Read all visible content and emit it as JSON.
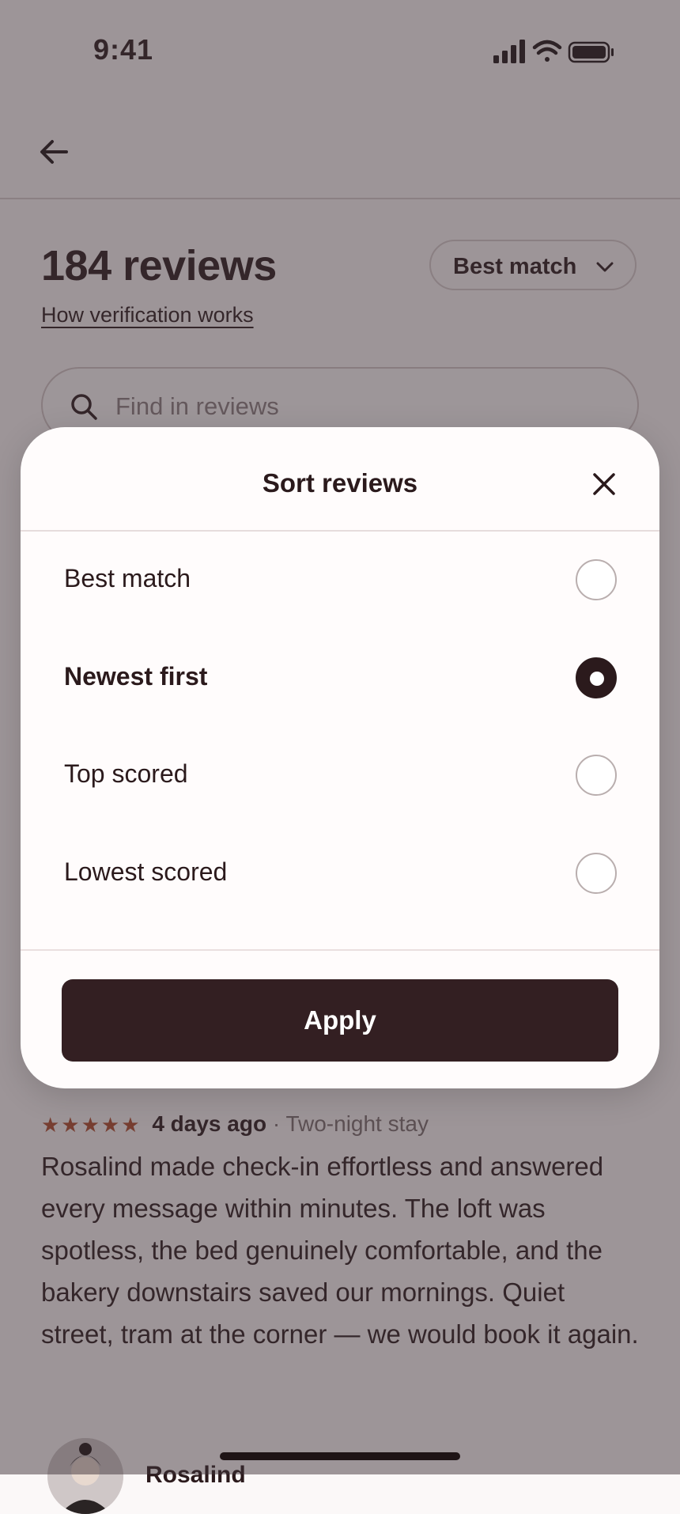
{
  "status_bar": {
    "time": "9:41"
  },
  "page": {
    "title": "184 reviews",
    "verification_link": "How verification works",
    "sort_pill_label": "Best match",
    "search_placeholder": "Find in reviews"
  },
  "review": {
    "stars": "★★★★★",
    "ago": "4 days ago",
    "stay": "· Two-night stay",
    "text": "Rosalind made check-in effortless and answered every message within minutes. The loft was spotless, the bed genuinely comfortable, and the bakery downstairs saved our mornings. Quiet street, tram at the corner — we would book it again.",
    "reviewer_name": "Rosalind"
  },
  "sort_sheet": {
    "title": "Sort reviews",
    "options": [
      {
        "label": "Best match",
        "selected": false
      },
      {
        "label": "Newest first",
        "selected": true
      },
      {
        "label": "Top scored",
        "selected": false
      },
      {
        "label": "Lowest scored",
        "selected": false
      }
    ],
    "apply_label": "Apply"
  },
  "colors": {
    "ink": "#2b1a1c",
    "button": "#331f22",
    "star": "#b04a2a",
    "scrim": "rgba(62,50,56,0.50)"
  },
  "icons": [
    "back-arrow-icon",
    "chevron-down-icon",
    "search-icon",
    "close-icon",
    "signal-icon",
    "wifi-icon",
    "battery-icon"
  ]
}
